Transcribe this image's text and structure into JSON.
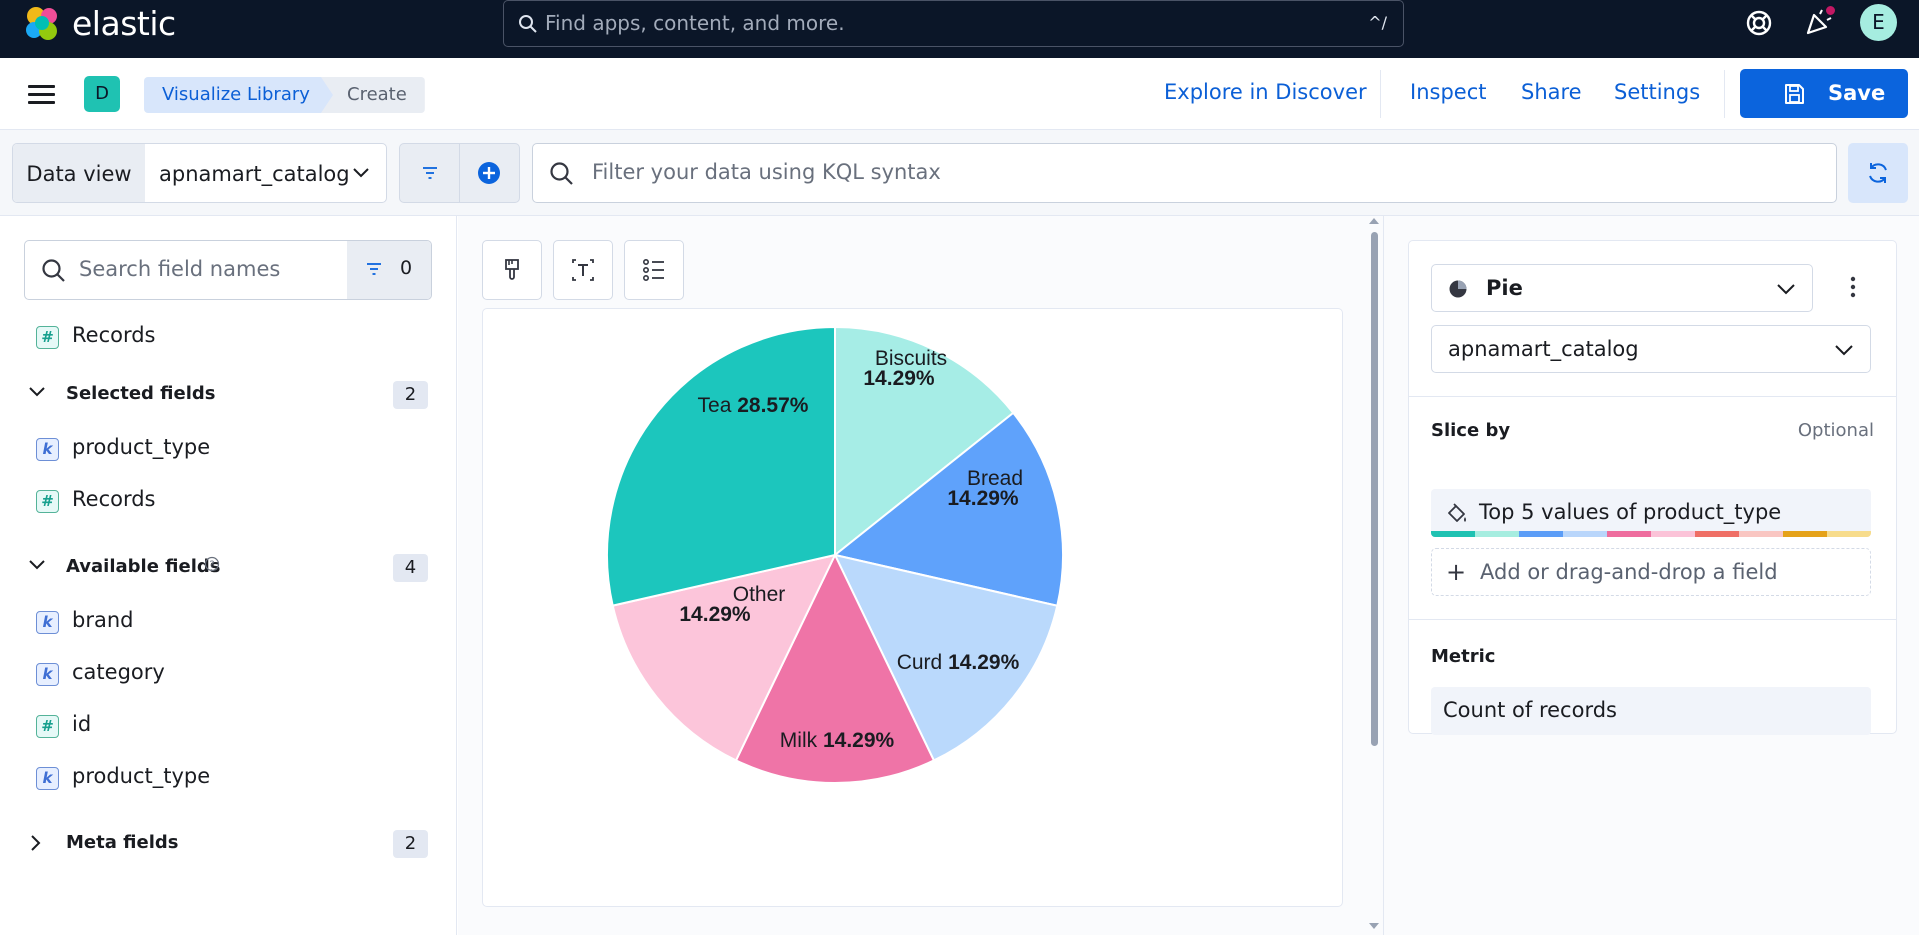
{
  "header": {
    "logo_text": "elastic",
    "search_placeholder": "Find apps, content, and more.",
    "search_shortcut": "^/",
    "avatar_initial": "E"
  },
  "appbar": {
    "space_initial": "D",
    "breadcrumbs": [
      "Visualize Library",
      "Create"
    ],
    "links": [
      "Explore in Discover",
      "Inspect",
      "Share",
      "Settings"
    ],
    "save_label": "Save"
  },
  "querybar": {
    "data_view_label": "Data view",
    "data_view_value": "apnamart_catalog",
    "kql_placeholder": "Filter your data using KQL syntax"
  },
  "fields": {
    "search_placeholder": "Search field names",
    "filter_count": "0",
    "records_label": "Records",
    "selected": {
      "title": "Selected fields",
      "count": "2",
      "items": [
        {
          "type": "k",
          "name": "product_type"
        },
        {
          "type": "#",
          "name": "Records"
        }
      ]
    },
    "available": {
      "title": "Available fields",
      "count": "4",
      "items": [
        {
          "type": "k",
          "name": "brand"
        },
        {
          "type": "k",
          "name": "category"
        },
        {
          "type": "#",
          "name": "id"
        },
        {
          "type": "k",
          "name": "product_type"
        }
      ]
    },
    "meta": {
      "title": "Meta fields",
      "count": "2"
    }
  },
  "config": {
    "chart_type": "Pie",
    "data_view": "apnamart_catalog",
    "slice_by_title": "Slice by",
    "slice_by_optional": "Optional",
    "slice_by_value": "Top 5 values of product_type",
    "add_field_label": "Add or drag-and-drop a field",
    "metric_title": "Metric",
    "metric_value": "Count of records",
    "palette": [
      "#1fc2b2",
      "#a6ede0",
      "#5b9df7",
      "#b9d6fb",
      "#ee6d9e",
      "#fbc3d8",
      "#ef6f66",
      "#f9c6c2",
      "#e5a219",
      "#f7dc8c"
    ]
  },
  "chart_data": {
    "type": "pie",
    "slices": [
      {
        "label": "Biscuits",
        "percent_label": "14.29%",
        "value": 14.29,
        "color": "#a6ede6"
      },
      {
        "label": "Bread",
        "percent_label": "14.29%",
        "value": 14.29,
        "color": "#5fa2fb"
      },
      {
        "label": "Curd",
        "percent_label": "14.29%",
        "value": 14.29,
        "color": "#bad9fc"
      },
      {
        "label": "Milk",
        "percent_label": "14.29%",
        "value": 14.29,
        "color": "#ef74a7"
      },
      {
        "label": "Other",
        "percent_label": "14.29%",
        "value": 14.29,
        "color": "#fcc5da"
      },
      {
        "label": "Tea",
        "percent_label": "28.57%",
        "value": 28.57,
        "color": "#1cc6bd"
      }
    ]
  }
}
